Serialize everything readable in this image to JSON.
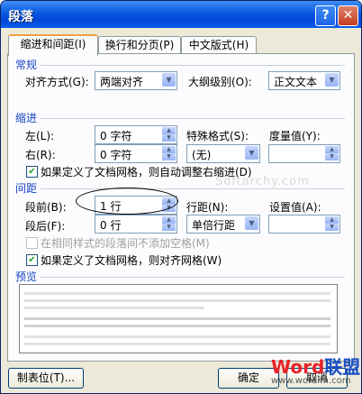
{
  "window": {
    "title": "段落",
    "help_glyph": "?",
    "close_glyph": "✕"
  },
  "tabs": [
    {
      "label": "缩进和间距(I)"
    },
    {
      "label": "换行和分页(P)"
    },
    {
      "label": "中文版式(H)"
    }
  ],
  "general": {
    "heading": "常规",
    "alignment_label": "对齐方式(G):",
    "alignment_value": "两端对齐",
    "outline_label": "大纲级别(O):",
    "outline_value": "正文文本"
  },
  "indent": {
    "heading": "缩进",
    "left_label": "左(L):",
    "left_value": "0 字符",
    "right_label": "右(R):",
    "right_value": "0 字符",
    "special_label": "特殊格式(S):",
    "special_value": "(无)",
    "by_label": "度量值(Y):",
    "by_value": "",
    "auto_adjust_label": "如果定义了文档网格，则自动调整右缩进(D)",
    "auto_adjust_checked": true
  },
  "spacing": {
    "heading": "间距",
    "before_label": "段前(B):",
    "before_value": "1 行",
    "after_label": "段后(F):",
    "after_value": "0 行",
    "line_label": "行距(N):",
    "line_value": "单倍行距",
    "at_label": "设置值(A):",
    "at_value": "",
    "no_space_label": "在相同样式的段落间不添加空格(M)",
    "no_space_checked": false,
    "snap_grid_label": "如果定义了文档网格，则对齐网格(W)",
    "snap_grid_checked": true
  },
  "preview": {
    "heading": "预览"
  },
  "buttons": {
    "tabs_label": "制表位(T)...",
    "ok_label": "确定",
    "cancel_label": "取消"
  },
  "overlay": {
    "watermark": "Softarchy.com",
    "logo_text": "Word联盟",
    "logo_url": "www.wordlm.com"
  },
  "colors": {
    "title_bar": "#0a58e0",
    "section_heading": "#1844c0",
    "checkmark": "#21a121"
  }
}
